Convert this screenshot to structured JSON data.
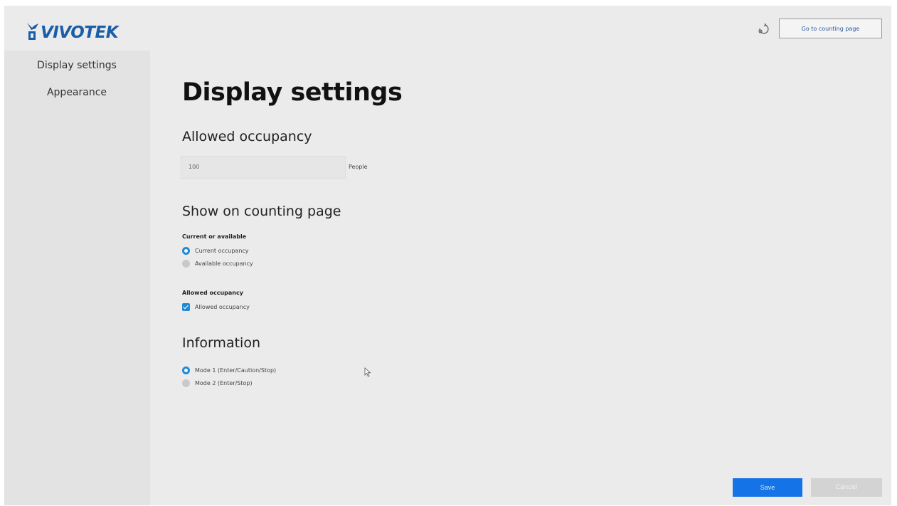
{
  "header": {
    "logo_text": "VIVOTEK",
    "refresh_icon": "refresh-icon",
    "goto_label": "Go to counting page"
  },
  "sidebar": {
    "items": [
      {
        "label": "Display settings"
      },
      {
        "label": "Appearance"
      }
    ]
  },
  "main": {
    "page_title": "Display settings",
    "allowed_occupancy": {
      "title": "Allowed occupancy",
      "value": "100",
      "unit": "People"
    },
    "show_on_counting": {
      "title": "Show on counting page",
      "current_or_available": {
        "label": "Current or available",
        "options": [
          {
            "label": "Current occupancy",
            "selected": true
          },
          {
            "label": "Available occupancy",
            "selected": false
          }
        ]
      },
      "allowed_group": {
        "label": "Allowed occupancy",
        "checkbox_label": "Allowed occupancy",
        "checked": true
      }
    },
    "information": {
      "title": "Information",
      "options": [
        {
          "label": "Mode 1 (Enter/Caution/Stop)",
          "selected": true
        },
        {
          "label": "Mode 2 (Enter/Stop)",
          "selected": false
        }
      ]
    }
  },
  "footer": {
    "save_label": "Save",
    "cancel_label": "Cancel"
  },
  "colors": {
    "accent": "#1473e6",
    "radio_checked": "#1f8ad6",
    "logo": "#1a5ea8",
    "background": "#ebebeb"
  }
}
